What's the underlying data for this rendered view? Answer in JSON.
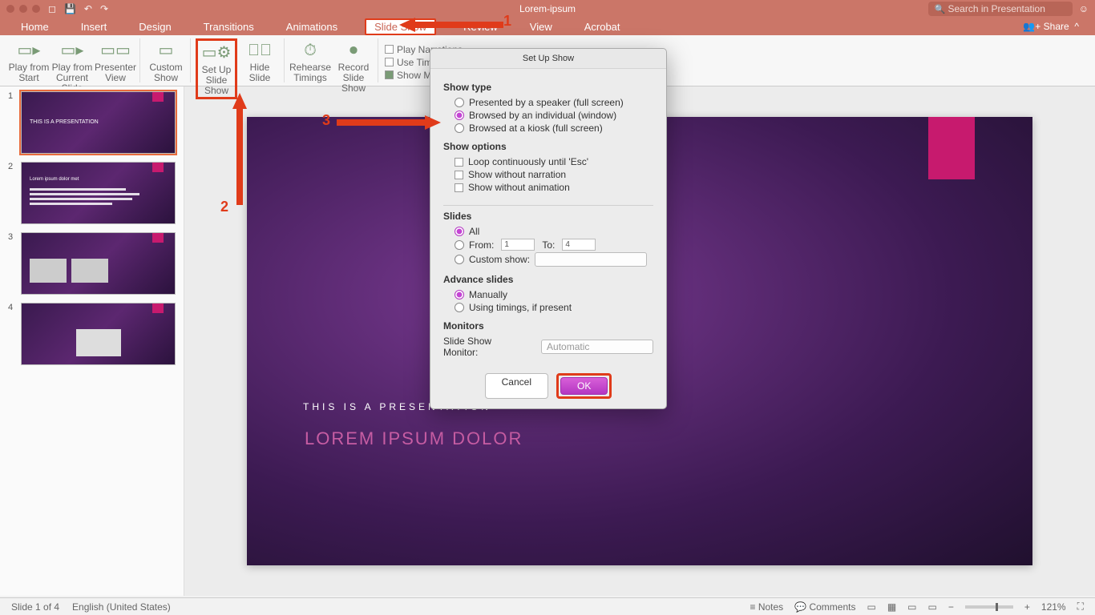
{
  "doc_title": "Lorem-ipsum",
  "search_placeholder": "Search in Presentation",
  "share_label": "Share",
  "tabs": [
    "Home",
    "Insert",
    "Design",
    "Transitions",
    "Animations",
    "Slide Show",
    "Review",
    "View",
    "Acrobat"
  ],
  "active_tab": "Slide Show",
  "ribbon": {
    "play_from_start": "Play from Start",
    "play_from_current": "Play from Current Slide",
    "presenter_view": "Presenter View",
    "custom_show": "Custom Show",
    "set_up": "Set Up Slide Show",
    "hide_slide": "Hide Slide",
    "rehearse": "Rehearse Timings",
    "record": "Record Slide Show",
    "opt_narrations": "Play Narrations",
    "opt_timings": "Use Timings",
    "opt_media": "Show Media Controls"
  },
  "slide": {
    "title": "THIS IS A PRESENTATION",
    "subtitle": "LOREM IPSUM DOLOR"
  },
  "thumbs": {
    "t1_title": "THIS IS A PRESENTATION",
    "t2_title": "Lorem ipsum dolor met"
  },
  "dialog": {
    "title": "Set Up Show",
    "show_type_h": "Show type",
    "presented": "Presented by a speaker (full screen)",
    "browsed_ind": "Browsed by an individual (window)",
    "browsed_kiosk": "Browsed at a kiosk (full screen)",
    "show_options_h": "Show options",
    "loop": "Loop continuously until 'Esc'",
    "no_narration": "Show without narration",
    "no_animation": "Show without animation",
    "slides_h": "Slides",
    "all": "All",
    "from_label": "From:",
    "to_label": "To:",
    "from_val": "1",
    "to_val": "4",
    "custom_show_label": "Custom show:",
    "advance_h": "Advance slides",
    "manually": "Manually",
    "using_timings": "Using timings, if present",
    "monitors_h": "Monitors",
    "monitor_label": "Slide Show Monitor:",
    "monitor_value": "Automatic",
    "cancel": "Cancel",
    "ok": "OK"
  },
  "status": {
    "slide": "Slide 1 of 4",
    "lang": "English (United States)",
    "notes": "Notes",
    "comments": "Comments",
    "zoom": "121%"
  },
  "annotations": {
    "n1": "1",
    "n2": "2",
    "n3": "3"
  }
}
